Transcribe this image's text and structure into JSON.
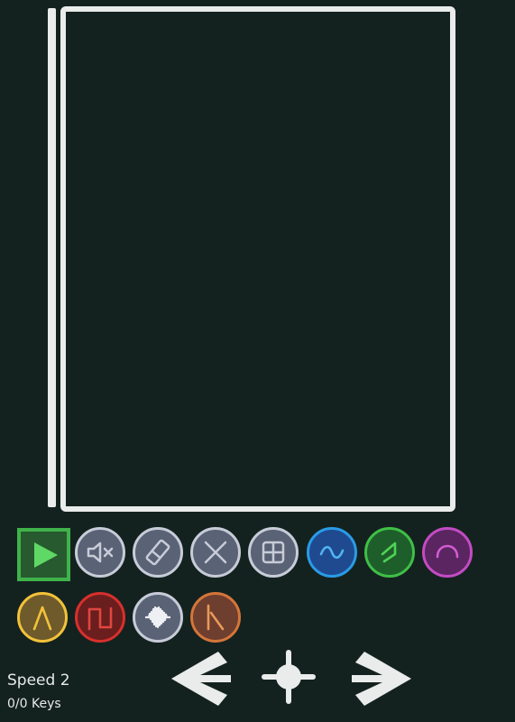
{
  "status": {
    "speed_label": "Speed 2",
    "keys_label": "0/0 Keys"
  },
  "tools": [
    {
      "name": "mute-tool",
      "icon": "speaker-mute-icon",
      "fill": "#5a6275",
      "border": "#c7ccd8",
      "glyph": "#c7ccd8"
    },
    {
      "name": "eraser-tool",
      "icon": "eraser-icon",
      "fill": "#5a6275",
      "border": "#c7ccd8",
      "glyph": "#c7ccd8"
    },
    {
      "name": "delete-tool",
      "icon": "x-icon",
      "fill": "#5a6275",
      "border": "#c7ccd8",
      "glyph": "#c7ccd8"
    },
    {
      "name": "grid-tool",
      "icon": "grid-icon",
      "fill": "#5a6275",
      "border": "#c7ccd8",
      "glyph": "#c7ccd8"
    },
    {
      "name": "sine-wave-tool",
      "icon": "sine-wave-icon",
      "fill": "#1f4a8f",
      "border": "#2a9be6",
      "glyph": "#4fb4f2"
    },
    {
      "name": "sawtooth-wave-tool",
      "icon": "sawtooth-wave-icon",
      "fill": "#1e5e2a",
      "border": "#3fbf47",
      "glyph": "#4fd257"
    },
    {
      "name": "arc-wave-tool",
      "icon": "arc-icon",
      "fill": "#5a2560",
      "border": "#c44bc4",
      "glyph": "#d35bd3"
    },
    {
      "name": "triangle-wave-tool",
      "icon": "triangle-wave-icon",
      "fill": "#6e5a2a",
      "border": "#f2c23a",
      "glyph": "#f2c23a"
    },
    {
      "name": "square-wave-tool",
      "icon": "square-wave-icon",
      "fill": "#6a1e1e",
      "border": "#d8302c",
      "glyph": "#e0463f"
    },
    {
      "name": "noise-tool",
      "icon": "noise-icon",
      "fill": "#5a6275",
      "border": "#c7ccd8",
      "glyph": "#eef0f4"
    },
    {
      "name": "drum-tool",
      "icon": "drum-stick-icon",
      "fill": "#6e3e2e",
      "border": "#d4763a",
      "glyph": "#e89a5a"
    }
  ],
  "colors": {
    "background": "#14221f",
    "frame": "#e9ecea",
    "play_accent": "#3fb34a"
  }
}
